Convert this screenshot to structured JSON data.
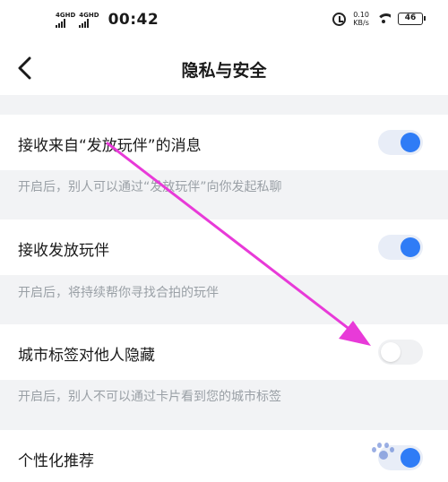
{
  "status_bar": {
    "sim1_label": "4GHD",
    "sim2_label": "4GHD",
    "time": "00:42",
    "speed_value": "0.10",
    "speed_unit": "KB/s",
    "battery": "46",
    "icons": [
      "signal-icon",
      "alarm-icon",
      "wifi-icon",
      "battery-icon"
    ]
  },
  "nav": {
    "title": "隐私与安全",
    "back_icon": "chevron-left-icon"
  },
  "settings": [
    {
      "label": "接收来自“发放玩伴”的消息",
      "enabled": true,
      "hint": "开启后，别人可以通过“发放玩伴”向你发起私聊"
    },
    {
      "label": "接收发放玩伴",
      "enabled": true,
      "hint": "开启后，将持续帮你寻找合拍的玩伴"
    },
    {
      "label": "城市标签对他人隐藏",
      "enabled": false,
      "hint": "开启后，别人不可以通过卡片看到您的城市标签"
    },
    {
      "label": "个性化推荐",
      "enabled": true,
      "hint": ""
    }
  ],
  "colors": {
    "accent": "#2f7cf6",
    "annotation_arrow": "#e83ad8",
    "hint_text": "#9aa0a6",
    "background": "#f2f3f5"
  }
}
